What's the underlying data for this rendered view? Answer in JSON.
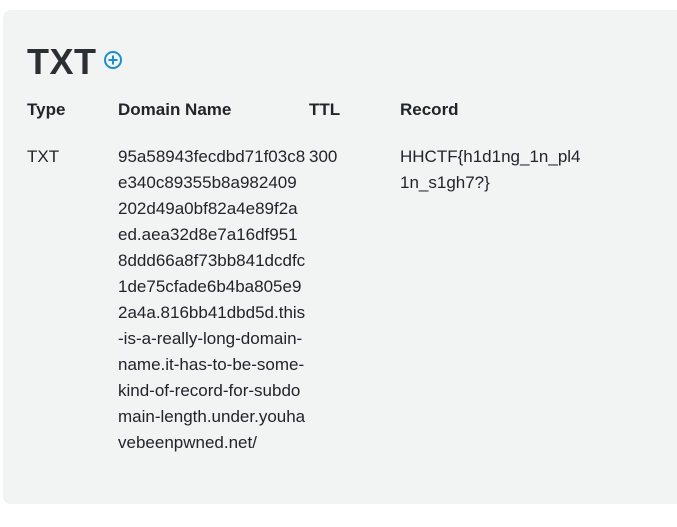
{
  "section": {
    "title": "TXT",
    "add_icon": "plus-circle-icon",
    "accent_color": "#1a8fd1"
  },
  "table": {
    "headers": {
      "type": "Type",
      "domain": "Domain Name",
      "ttl": "TTL",
      "record": "Record"
    },
    "rows": [
      {
        "type": "TXT",
        "domain": "95a58943fecdbd71f03c8e340c89355b8a982409202d49a0bf82a4e89f2aed.aea32d8e7a16df9518ddd66a8f73bb841dcdfc1de75cfade6b4ba805e92a4a.816bb41dbd5d.this-is-a-really-long-domain-name.it-has-to-be-some-kind-of-record-for-subdomain-length.under.youhavebeenpwned.net/",
        "ttl": "300",
        "record": "HHCTF{h1d1ng_1n_pl41n_s1gh7?}"
      }
    ]
  }
}
